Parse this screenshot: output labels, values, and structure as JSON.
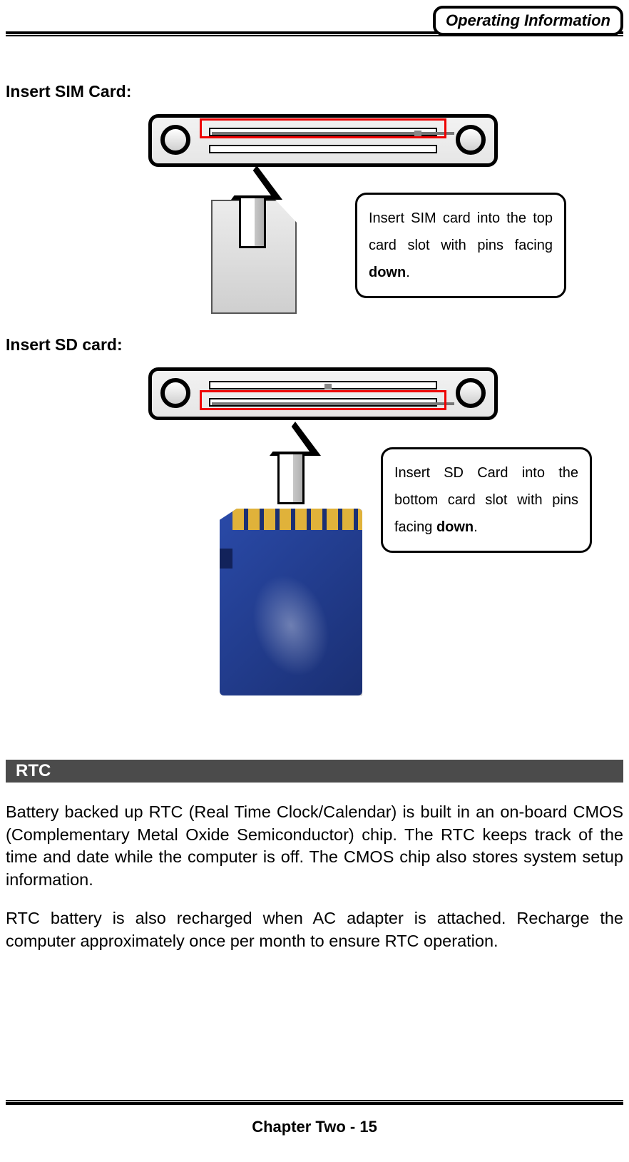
{
  "header": {
    "tag": "Operating Information"
  },
  "sections": {
    "sim": {
      "title": "Insert SIM Card:",
      "callout_pre": "Insert SIM card into the top card slot with pins facing ",
      "callout_bold": "down",
      "callout_post": "."
    },
    "sd": {
      "title": "Insert SD card:",
      "callout_pre": "Insert SD Card into the bottom card slot with pins facing ",
      "callout_bold": "down",
      "callout_post": "."
    },
    "rtc": {
      "bar": "RTC",
      "p1": "Battery backed up RTC (Real Time Clock/Calendar) is built in an on-board CMOS (Complementary Metal Oxide Semiconductor) chip. The RTC keeps track of the time and date while the computer is off. The CMOS chip also stores system setup information.",
      "p2": "RTC battery is also recharged when AC adapter is attached. Recharge the computer approximately once per month to ensure RTC operation."
    }
  },
  "footer": {
    "text": "Chapter Two - 15"
  }
}
